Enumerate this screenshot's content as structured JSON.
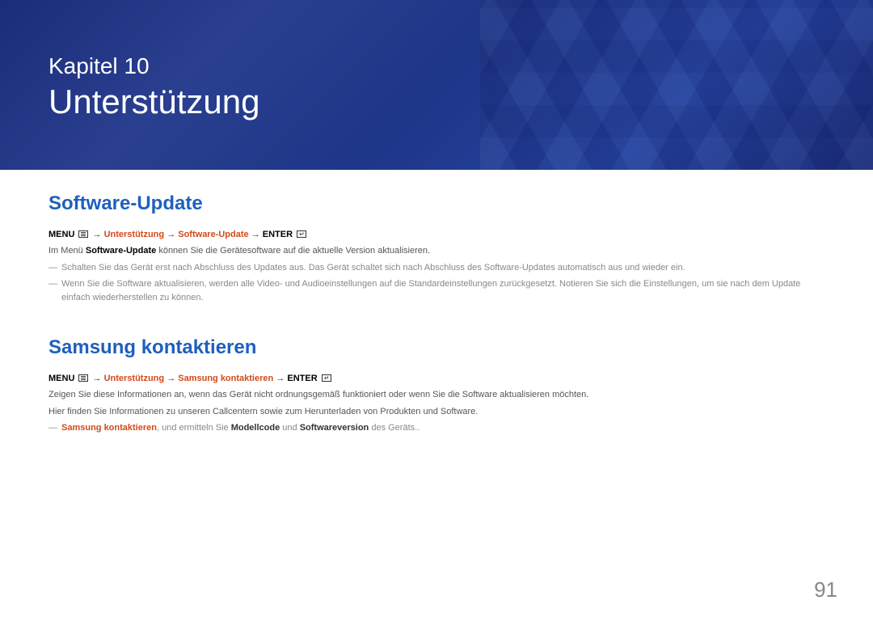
{
  "header": {
    "chapter_label": "Kapitel 10",
    "chapter_title": "Unterstützung"
  },
  "section1": {
    "heading": "Software-Update",
    "nav_menu": "MENU",
    "nav_arrow": " → ",
    "nav_part1": "Unterstützung",
    "nav_part2": "Software-Update",
    "nav_enter": "ENTER",
    "body_prefix": "Im Menü ",
    "body_bold": "Software-Update",
    "body_suffix": " können Sie die Gerätesoftware auf die aktuelle Version aktualisieren.",
    "note1": "Schalten Sie das Gerät erst nach Abschluss des Updates aus. Das Gerät schaltet sich nach Abschluss des Software-Updates automatisch aus und wieder ein.",
    "note2": "Wenn Sie die Software aktualisieren, werden alle Video- und Audioeinstellungen auf die Standardeinstellungen zurückgesetzt. Notieren Sie sich die Einstellungen, um sie nach dem Update einfach wiederherstellen zu können."
  },
  "section2": {
    "heading": "Samsung kontaktieren",
    "nav_menu": "MENU",
    "nav_arrow": " → ",
    "nav_part1": "Unterstützung",
    "nav_part2": "Samsung kontaktieren",
    "nav_enter": "ENTER",
    "body1": "Zeigen Sie diese Informationen an, wenn das Gerät nicht ordnungsgemäß funktioniert oder wenn Sie die Software aktualisieren möchten.",
    "body2": "Hier finden Sie Informationen zu unseren Callcentern sowie zum Herunterladen von Produkten und Software.",
    "note_orange1": "Samsung kontaktieren",
    "note_mid1": ", und ermitteln Sie ",
    "note_bold1": "Modellcode",
    "note_mid2": " und ",
    "note_bold2": "Softwareversion",
    "note_suffix": " des Geräts.."
  },
  "page_number": "91"
}
